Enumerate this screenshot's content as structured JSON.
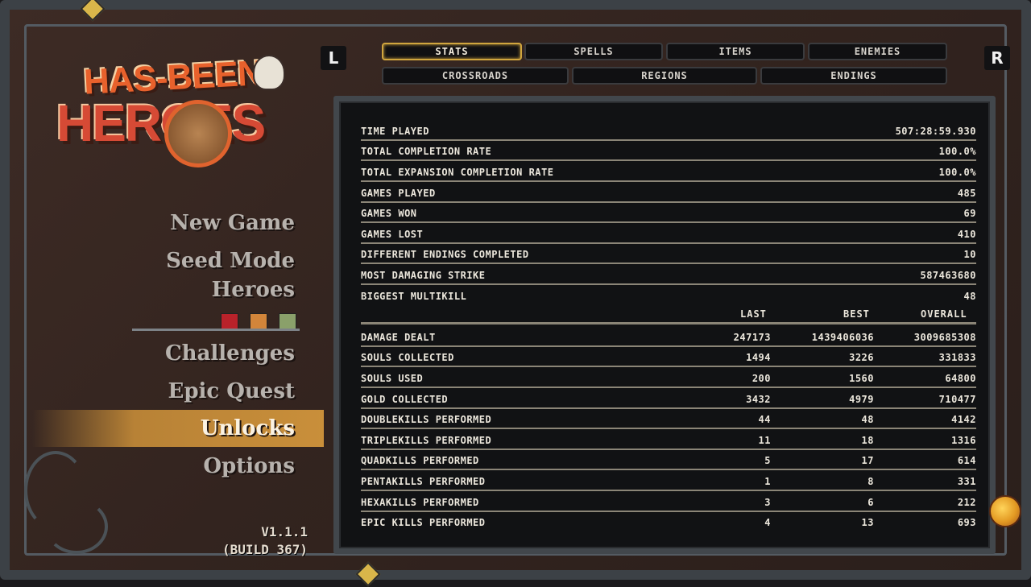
{
  "logo": {
    "line1": "HAS-BEEN",
    "line2": "HEROES"
  },
  "shoulder": {
    "left": "L",
    "right": "R"
  },
  "tabs_row1": [
    "STATS",
    "SPELLS",
    "ITEMS",
    "ENEMIES"
  ],
  "tabs_row2": [
    "CROSSROADS",
    "REGIONS",
    "ENDINGS"
  ],
  "active_tab": "STATS",
  "menu": {
    "new_game": "New Game",
    "seed_mode": "Seed Mode",
    "heroes": "Heroes",
    "challenges": "Challenges",
    "epic_quest": "Epic Quest",
    "unlocks": "Unlocks",
    "options": "Options",
    "active": "Unlocks"
  },
  "version": {
    "number": "V1.1.1",
    "build": "(BUILD 367)"
  },
  "stats": [
    {
      "label": "TIME PLAYED",
      "value": "507:28:59.930"
    },
    {
      "label": "TOTAL COMPLETION RATE",
      "value": "100.0%"
    },
    {
      "label": "TOTAL EXPANSION COMPLETION RATE",
      "value": "100.0%"
    },
    {
      "label": "GAMES PLAYED",
      "value": "485"
    },
    {
      "label": "GAMES WON",
      "value": "69"
    },
    {
      "label": "GAMES LOST",
      "value": "410"
    },
    {
      "label": "DIFFERENT ENDINGS COMPLETED",
      "value": "10"
    },
    {
      "label": "MOST DAMAGING STRIKE",
      "value": "587463680"
    },
    {
      "label": "BIGGEST MULTIKILL",
      "value": "48"
    }
  ],
  "columns": {
    "last": "LAST",
    "best": "BEST",
    "overall": "OVERALL"
  },
  "records": [
    {
      "label": "DAMAGE DEALT",
      "last": "247173",
      "best": "1439406036",
      "overall": "3009685308"
    },
    {
      "label": "SOULS COLLECTED",
      "last": "1494",
      "best": "3226",
      "overall": "331833"
    },
    {
      "label": "SOULS USED",
      "last": "200",
      "best": "1560",
      "overall": "64800"
    },
    {
      "label": "GOLD COLLECTED",
      "last": "3432",
      "best": "4979",
      "overall": "710477"
    },
    {
      "label": "DOUBLEKILLS PERFORMED",
      "last": "44",
      "best": "48",
      "overall": "4142"
    },
    {
      "label": "TRIPLEKILLS PERFORMED",
      "last": "11",
      "best": "18",
      "overall": "1316"
    },
    {
      "label": "QUADKILLS PERFORMED",
      "last": "5",
      "best": "17",
      "overall": "614"
    },
    {
      "label": "PENTAKILLS PERFORMED",
      "last": "1",
      "best": "8",
      "overall": "331"
    },
    {
      "label": "HEXAKILLS PERFORMED",
      "last": "3",
      "best": "6",
      "overall": "212"
    },
    {
      "label": "EPIC KILLS PERFORMED",
      "last": "4",
      "best": "13",
      "overall": "693"
    }
  ],
  "colors": {
    "accent": "#d1a63e",
    "active_menu": "#c98f3a",
    "panel": "#111214",
    "frame": "#3c4146"
  }
}
